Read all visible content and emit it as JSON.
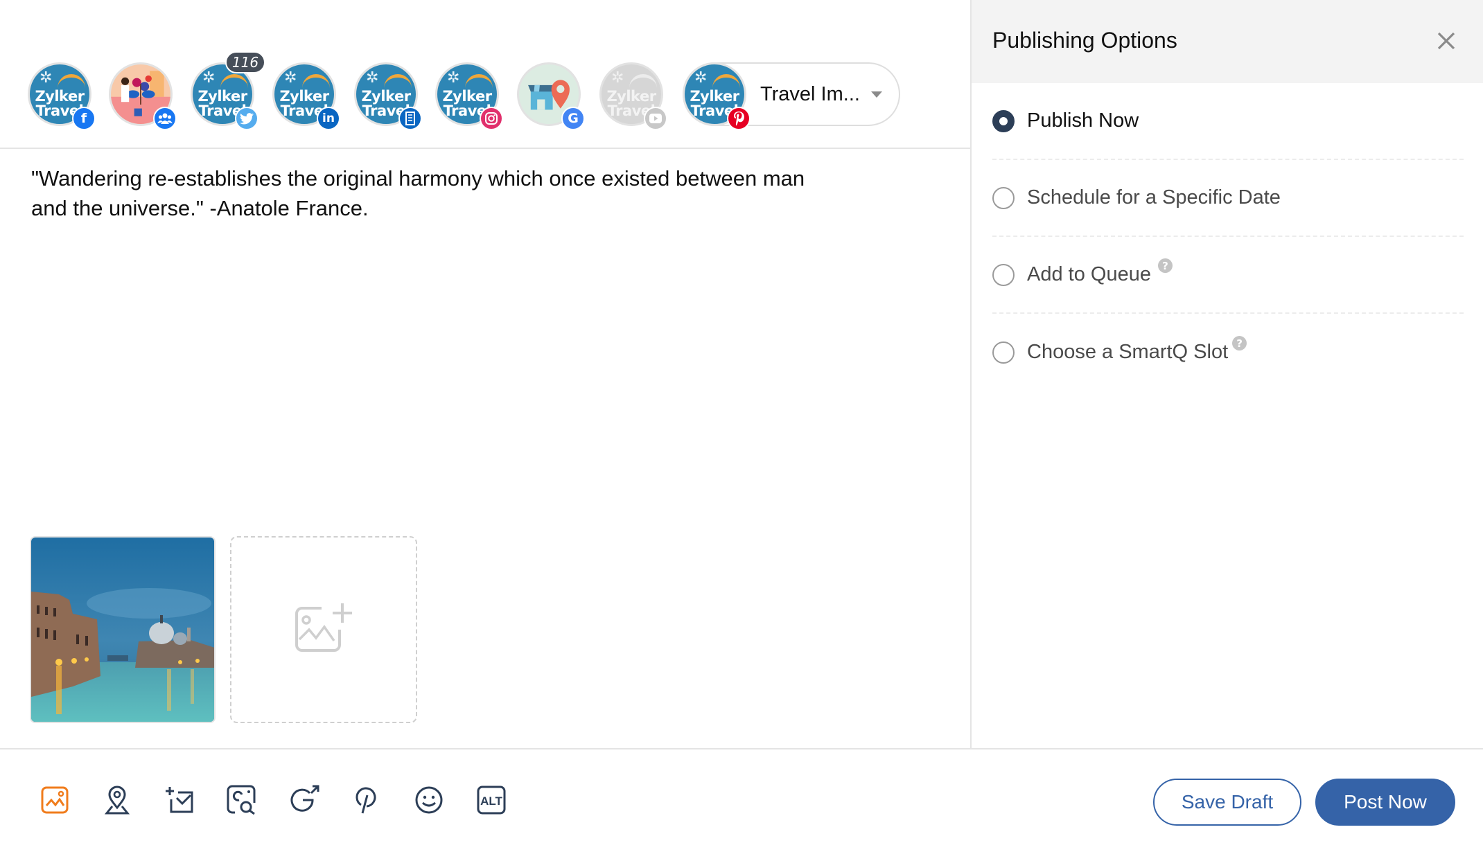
{
  "accounts": [
    {
      "name": "Zylker Travel",
      "network": "facebook",
      "icon": "facebook-icon",
      "badge_glyph": "f",
      "badge_color": "#1877f2",
      "logo_lines": [
        "Zylker",
        "Travel"
      ],
      "muted": false
    },
    {
      "name": "Community group",
      "network": "facebook-group",
      "icon": "group-icon",
      "badge_glyph": "",
      "badge_color": "#1877f2",
      "muted": false
    },
    {
      "name": "Zylker Travel",
      "network": "twitter",
      "icon": "twitter-icon",
      "badge_glyph": "",
      "badge_color": "#55acee",
      "logo_lines": [
        "Zylker",
        "Travel"
      ],
      "muted": false,
      "count": "116"
    },
    {
      "name": "Zylker Travel",
      "network": "linkedin",
      "icon": "linkedin-icon",
      "badge_glyph": "in",
      "badge_color": "#0a66c2",
      "logo_lines": [
        "Zylker",
        "Travel"
      ],
      "muted": false
    },
    {
      "name": "Zylker Travel",
      "network": "linkedin-company",
      "icon": "building-icon",
      "badge_glyph": "",
      "badge_color": "#0a66c2",
      "logo_lines": [
        "Zylker",
        "Travel"
      ],
      "muted": false
    },
    {
      "name": "Zylker Travel",
      "network": "instagram",
      "icon": "instagram-icon",
      "badge_glyph": "",
      "badge_color": "#e1306c",
      "logo_lines": [
        "Zylker",
        "Travel"
      ],
      "muted": false
    },
    {
      "name": "Google Business Profile",
      "network": "google",
      "icon": "google-icon",
      "badge_glyph": "G",
      "badge_color": "#4285f4",
      "muted": false
    },
    {
      "name": "Zylker Travel",
      "network": "youtube",
      "icon": "youtube-icon",
      "badge_glyph": "",
      "badge_color": "#c8c8c8",
      "logo_lines": [
        "Zylker",
        "Travel"
      ],
      "muted": true
    },
    {
      "name": "Zylker Travel",
      "network": "pinterest",
      "icon": "pinterest-icon",
      "badge_glyph": "",
      "badge_color": "#e60023",
      "logo_lines": [
        "Zylker",
        "Travel"
      ],
      "muted": false
    }
  ],
  "board_selector": {
    "label": "Travel Im...",
    "caret": "chevron-down-icon"
  },
  "composer": {
    "text": "\"Wandering re-establishes the original harmony which once existed between man and the universe.\"  -Anatole France.",
    "media": [
      {
        "alt": "Venice Grand Canal at dusk",
        "type": "image"
      }
    ],
    "add_media_icon": "add-image-icon"
  },
  "toolbar": [
    {
      "name": "media-library",
      "icon": "image-icon",
      "active": true,
      "color": "#f07c1c"
    },
    {
      "name": "location",
      "icon": "location-pin-icon",
      "active": false
    },
    {
      "name": "add-message",
      "icon": "add-mail-icon",
      "active": false
    },
    {
      "name": "image-search",
      "icon": "image-search-icon",
      "active": false
    },
    {
      "name": "google-share",
      "icon": "google-share-icon",
      "active": false
    },
    {
      "name": "pinterest-board",
      "icon": "pinterest-icon",
      "active": false
    },
    {
      "name": "emoji",
      "icon": "emoji-icon",
      "active": false
    },
    {
      "name": "alt-text",
      "icon": "alt-text-icon",
      "active": false,
      "label": "ALT"
    }
  ],
  "publishing": {
    "title": "Publishing Options",
    "close_icon": "close-icon",
    "options": [
      {
        "label": "Publish Now",
        "selected": true,
        "help": false
      },
      {
        "label": "Schedule for a Specific Date",
        "selected": false,
        "help": false
      },
      {
        "label": "Add to Queue",
        "selected": false,
        "help": true
      },
      {
        "label": "Choose a SmartQ Slot",
        "selected": false,
        "help": true
      }
    ],
    "help_glyph": "?"
  },
  "actions": {
    "save_draft": "Save Draft",
    "post_now": "Post Now"
  },
  "colors": {
    "primary": "#3563a8",
    "accent": "#f07c1c",
    "icon": "#2c3e57",
    "radio_checked": "#2c3e57"
  }
}
